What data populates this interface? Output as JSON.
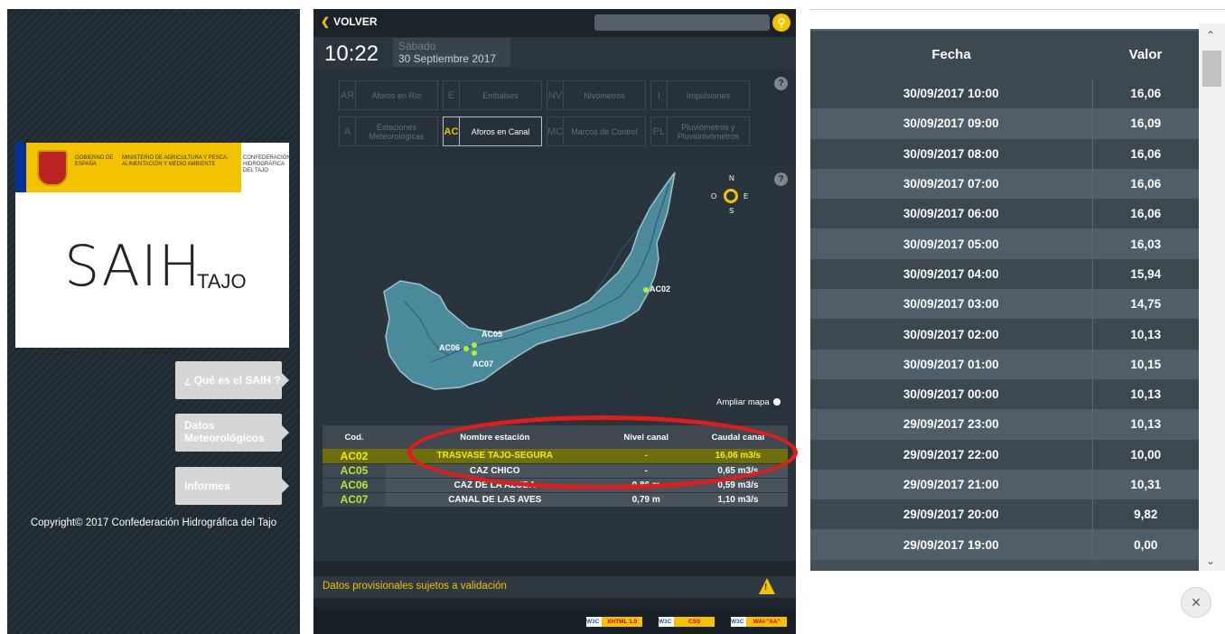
{
  "left": {
    "gov": {
      "gobierno": "GOBIERNO DE ESPAÑA",
      "ministerio": "MINISTERIO DE AGRICULTURA Y PESCA, ALIMENTACIÓN Y MEDIO AMBIENTE",
      "confederacion": "CONFEDERACIÓN HIDROGRÁFICA DEL TAJO"
    },
    "logo": {
      "main": "SAIH",
      "sub": "TAJO"
    },
    "buttons": [
      {
        "label": "¿ Qué es el SAIH ?"
      },
      {
        "label": "Datos Meteorológicos"
      },
      {
        "label": "Informes"
      }
    ],
    "copyright": "Copyright© 2017 Confederación Hidrográfica del Tajo"
  },
  "middle": {
    "back_label": "VOLVER",
    "search": {
      "placeholder": ""
    },
    "time": "10:22",
    "day": "Sábado",
    "date": "30 Septiembre 2017",
    "categories": [
      {
        "code": "AR",
        "label": "Aforos en Río",
        "active": false
      },
      {
        "code": "E",
        "label": "Embalses",
        "active": false
      },
      {
        "code": "NV",
        "label": "Nivómetros",
        "active": false
      },
      {
        "code": "I",
        "label": "Impulsiones",
        "active": false
      },
      {
        "code": "A",
        "label": "Estaciones Meteorológicas",
        "active": false
      },
      {
        "code": "AC",
        "label": "Aforos en Canal",
        "active": true
      },
      {
        "code": "MC",
        "label": "Marcos de Control",
        "active": false
      },
      {
        "code": "PL",
        "label": "Pluviómetros y Pluvionivómetros",
        "active": false
      }
    ],
    "help": "?",
    "compass": {
      "n": "N",
      "s": "S",
      "e": "E",
      "o": "O"
    },
    "map_stations": [
      {
        "code": "AC02"
      },
      {
        "code": "AC05"
      },
      {
        "code": "AC06"
      },
      {
        "code": "AC07"
      }
    ],
    "ampliar": "Ampliar mapa",
    "table": {
      "headers": [
        "Cod.",
        "Nombre estación",
        "Nivel canal",
        "Caudal canal"
      ],
      "rows": [
        {
          "code": "AC02",
          "name": "TRASVASE TAJO-SEGURA",
          "nivel": "-",
          "caudal": "16,06 m3/s"
        },
        {
          "code": "AC05",
          "name": "CAZ CHICO",
          "nivel": "-",
          "caudal": "0,65 m3/s"
        },
        {
          "code": "AC06",
          "name": "CAZ DE LA AZUDA",
          "nivel": "0,86 m",
          "caudal": "0,59 m3/s"
        },
        {
          "code": "AC07",
          "name": "CANAL DE LAS AVES",
          "nivel": "0,79 m",
          "caudal": "1,10 m3/s"
        }
      ]
    },
    "note": "Datos provisionales sujetos a validación",
    "badges": [
      {
        "w3c": "W3C",
        "text": "XHTML 1.0"
      },
      {
        "w3c": "W3C",
        "text": "CSS"
      },
      {
        "w3c": "W3C",
        "text": "WAI-\"AA\""
      }
    ]
  },
  "right": {
    "headers": [
      "Fecha",
      "Valor"
    ],
    "rows": [
      {
        "fecha": "30/09/2017 10:00",
        "valor": "16,06"
      },
      {
        "fecha": "30/09/2017 09:00",
        "valor": "16,09"
      },
      {
        "fecha": "30/09/2017 08:00",
        "valor": "16,06"
      },
      {
        "fecha": "30/09/2017 07:00",
        "valor": "16,06"
      },
      {
        "fecha": "30/09/2017 06:00",
        "valor": "16,06"
      },
      {
        "fecha": "30/09/2017 05:00",
        "valor": "16,03"
      },
      {
        "fecha": "30/09/2017 04:00",
        "valor": "15,94"
      },
      {
        "fecha": "30/09/2017 03:00",
        "valor": "14,75"
      },
      {
        "fecha": "30/09/2017 02:00",
        "valor": "10,13"
      },
      {
        "fecha": "30/09/2017 01:00",
        "valor": "10,15"
      },
      {
        "fecha": "30/09/2017 00:00",
        "valor": "10,13"
      },
      {
        "fecha": "29/09/2017 23:00",
        "valor": "10,13"
      },
      {
        "fecha": "29/09/2017 22:00",
        "valor": "10,00"
      },
      {
        "fecha": "29/09/2017 21:00",
        "valor": "10,31"
      },
      {
        "fecha": "29/09/2017 20:00",
        "valor": "9,82"
      },
      {
        "fecha": "29/09/2017 19:00",
        "valor": "0,00"
      }
    ],
    "close": "×"
  }
}
